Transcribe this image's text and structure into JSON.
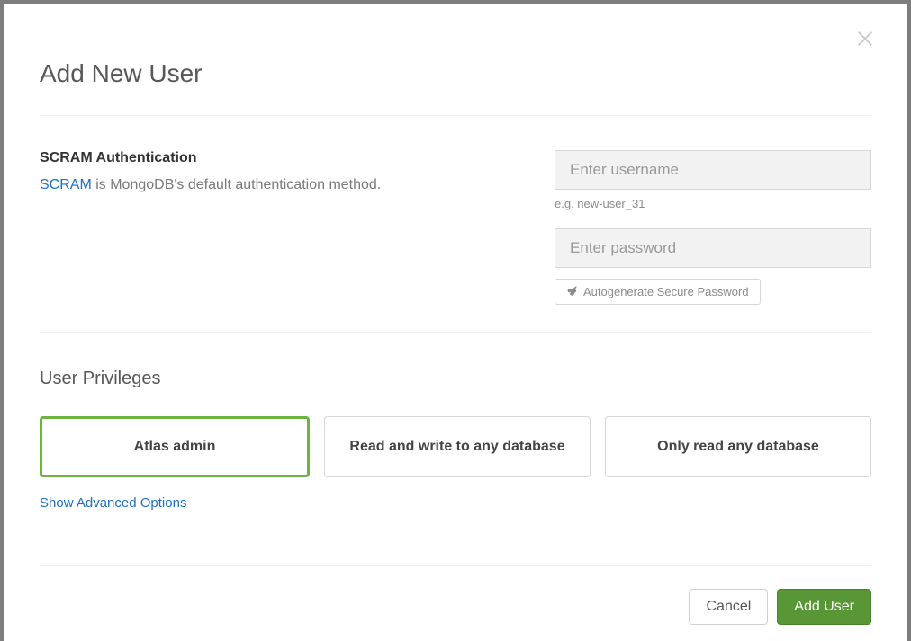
{
  "modal": {
    "title": "Add New User"
  },
  "auth": {
    "heading": "SCRAM Authentication",
    "link_text": "SCRAM",
    "desc_suffix": " is MongoDB's default authentication method."
  },
  "form": {
    "username_placeholder": "Enter username",
    "username_hint": "e.g. new-user_31",
    "password_placeholder": "Enter password",
    "autogen_label": "Autogenerate Secure Password"
  },
  "privileges": {
    "heading": "User Privileges",
    "options": [
      {
        "label": "Atlas admin",
        "selected": true
      },
      {
        "label": "Read and write to any database",
        "selected": false
      },
      {
        "label": "Only read any database",
        "selected": false
      }
    ],
    "advanced_link": "Show Advanced Options"
  },
  "footer": {
    "cancel": "Cancel",
    "submit": "Add User"
  }
}
